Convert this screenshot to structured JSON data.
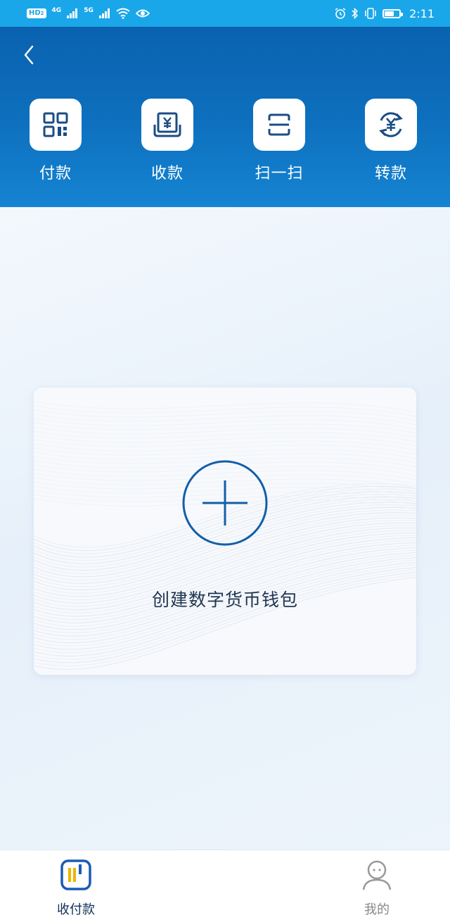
{
  "status_bar": {
    "hd_badge": "HD",
    "hd_sub": "2",
    "net_1": "4G",
    "net_2": "5G",
    "time": "2:11"
  },
  "header": {
    "actions": [
      {
        "label": "付款",
        "icon": "qr-code-icon"
      },
      {
        "label": "收款",
        "icon": "receive-yuan-icon"
      },
      {
        "label": "扫一扫",
        "icon": "scan-icon"
      },
      {
        "label": "转款",
        "icon": "transfer-yuan-icon"
      }
    ]
  },
  "card": {
    "label": "创建数字货币钱包",
    "icon": "plus-circle-icon"
  },
  "tabbar": {
    "items": [
      {
        "label": "收付款",
        "icon": "payment-wallet-icon",
        "active": true
      },
      {
        "label": "我的",
        "icon": "user-profile-icon",
        "active": false
      }
    ]
  },
  "colors": {
    "status_bar": "#1aa7ea",
    "header_top": "#0a62b0",
    "accent": "#125fa8",
    "tab_active_accent": "#f0b400"
  }
}
